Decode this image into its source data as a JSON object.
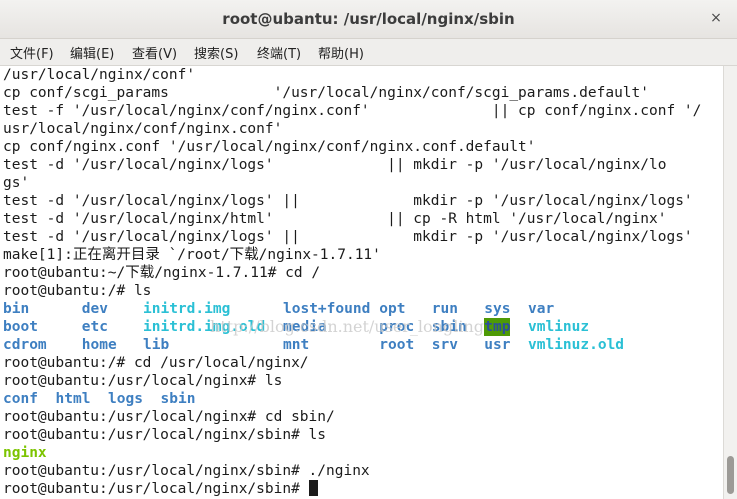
{
  "window": {
    "title": "root@ubantu: /usr/local/nginx/sbin",
    "close_icon": "×"
  },
  "menu": {
    "items": [
      "文件(F)",
      "编辑(E)",
      "查看(V)",
      "搜索(S)",
      "终端(T)",
      "帮助(H)"
    ]
  },
  "terminal": {
    "lines": [
      "/usr/local/nginx/conf'",
      "cp conf/scgi_params            '/usr/local/nginx/conf/scgi_params.default'",
      "test -f '/usr/local/nginx/conf/nginx.conf'              || cp conf/nginx.conf '/",
      "usr/local/nginx/conf/nginx.conf'",
      "cp conf/nginx.conf '/usr/local/nginx/conf/nginx.conf.default'",
      "test -d '/usr/local/nginx/logs'             || mkdir -p '/usr/local/nginx/lo",
      "gs'",
      "test -d '/usr/local/nginx/logs' ||             mkdir -p '/usr/local/nginx/logs'",
      "test -d '/usr/local/nginx/html'             || cp -R html '/usr/local/nginx'",
      "test -d '/usr/local/nginx/logs' ||             mkdir -p '/usr/local/nginx/logs'",
      "make[1]:正在离开目录 `/root/下载/nginx-1.7.11'",
      "root@ubantu:~/下载/nginx-1.7.11# cd /",
      "root@ubantu:/# ls"
    ],
    "ls_root": [
      [
        {
          "t": "bin",
          "c": "dir"
        },
        {
          "t": "dev",
          "c": "dir"
        },
        {
          "t": "initrd.img",
          "c": "cyan"
        },
        {
          "t": "lost+found",
          "c": "dir"
        },
        {
          "t": "opt",
          "c": "dir"
        },
        {
          "t": "run",
          "c": "dir"
        },
        {
          "t": "sys",
          "c": "dir"
        },
        {
          "t": "var",
          "c": "dir"
        }
      ],
      [
        {
          "t": "boot",
          "c": "dir"
        },
        {
          "t": "etc",
          "c": "dir"
        },
        {
          "t": "initrd.img.old",
          "c": "cyan"
        },
        {
          "t": "media",
          "c": "dir"
        },
        {
          "t": "proc",
          "c": "dir"
        },
        {
          "t": "sbin",
          "c": "dir"
        },
        {
          "t": "tmp",
          "c": "tmp"
        },
        {
          "t": "vmlinuz",
          "c": "cyan"
        }
      ],
      [
        {
          "t": "cdrom",
          "c": "dir"
        },
        {
          "t": "home",
          "c": "dir"
        },
        {
          "t": "lib",
          "c": "dir"
        },
        {
          "t": "mnt",
          "c": "dir"
        },
        {
          "t": "root",
          "c": "dir"
        },
        {
          "t": "srv",
          "c": "dir"
        },
        {
          "t": "usr",
          "c": "dir"
        },
        {
          "t": "vmlinuz.old",
          "c": "cyan"
        }
      ]
    ],
    "after_ls": [
      "root@ubantu:/# cd /usr/local/nginx/",
      "root@ubantu:/usr/local/nginx# ls"
    ],
    "ls_nginx": [
      "conf",
      "html",
      "logs",
      "sbin"
    ],
    "after_ls_nginx": [
      "root@ubantu:/usr/local/nginx# cd sbin/",
      "root@ubantu:/usr/local/nginx/sbin# ls"
    ],
    "ls_sbin": "nginx",
    "final_lines": [
      "root@ubantu:/usr/local/nginx/sbin# ./nginx",
      "root@ubantu:/usr/local/nginx/sbin# "
    ],
    "watermark": "http://blog.csdn.net/user_longling"
  },
  "colors": {
    "directory": "#3e7fc1",
    "symlink": "#2bc0d5",
    "executable": "#7cc400",
    "sticky_bg": "#4e9a06"
  }
}
